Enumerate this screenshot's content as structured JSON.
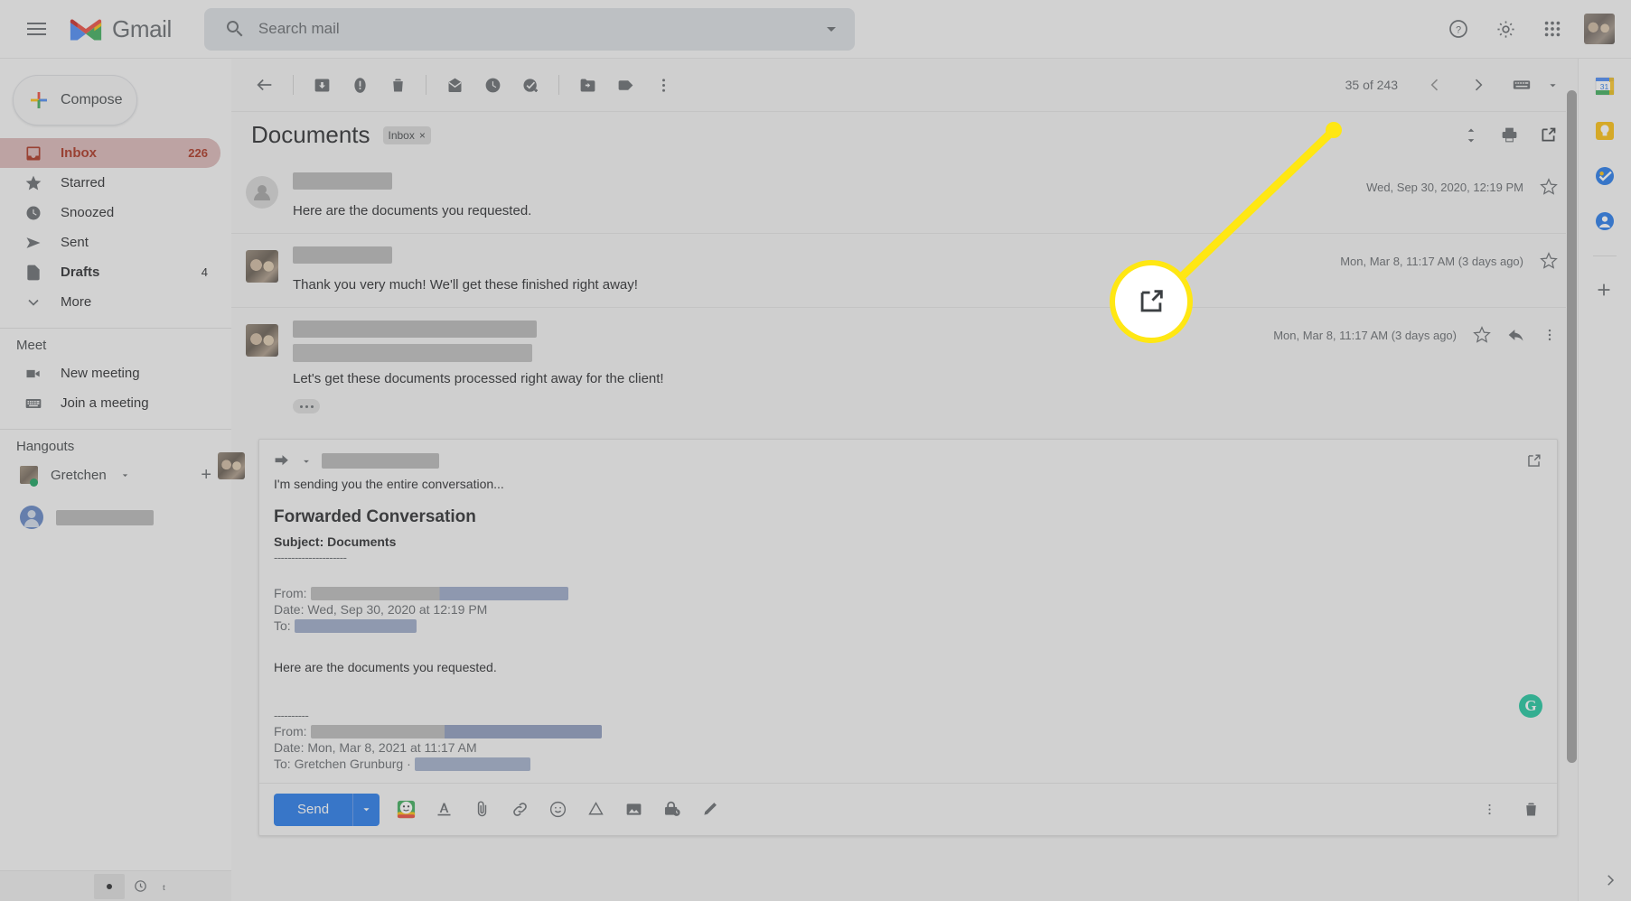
{
  "app": {
    "name": "Gmail"
  },
  "header": {
    "menu_icon": "hamburger-icon",
    "logo_icon": "gmail-logo-icon",
    "brand": "Gmail",
    "search": {
      "placeholder": "Search mail",
      "value": "",
      "icon": "search-icon",
      "options_icon": "chevron-down-icon"
    },
    "help_icon": "help-icon",
    "settings_icon": "gear-icon",
    "apps_icon": "apps-grid-icon",
    "avatar": "account-avatar"
  },
  "sidebar": {
    "compose": {
      "label": "Compose",
      "icon": "plus-icon"
    },
    "items": [
      {
        "label": "Inbox",
        "count": "226",
        "icon": "inbox-icon",
        "active": true
      },
      {
        "label": "Starred",
        "count": "",
        "icon": "star-icon",
        "active": false
      },
      {
        "label": "Snoozed",
        "count": "",
        "icon": "clock-icon",
        "active": false
      },
      {
        "label": "Sent",
        "count": "",
        "icon": "send-icon",
        "active": false
      },
      {
        "label": "Drafts",
        "count": "4",
        "icon": "draft-icon",
        "active": false
      },
      {
        "label": "More",
        "count": "",
        "icon": "chevron-down-icon",
        "active": false
      }
    ],
    "meet": {
      "title": "Meet",
      "items": [
        {
          "label": "New meeting",
          "icon": "video-camera-icon"
        },
        {
          "label": "Join a meeting",
          "icon": "keyboard-icon"
        }
      ]
    },
    "hangouts": {
      "title": "Hangouts",
      "user": "Gretchen",
      "status_icon": "online-dot-icon",
      "dropdown_icon": "caret-down-icon",
      "add_icon": "plus-icon",
      "contact_name_redacted": true
    }
  },
  "toolbar": {
    "back_icon": "back-arrow-icon",
    "archive_icon": "archive-icon",
    "spam_icon": "report-spam-icon",
    "delete_icon": "trash-icon",
    "unread_icon": "mark-unread-icon",
    "snooze_icon": "snooze-clock-icon",
    "tasks_icon": "add-to-tasks-icon",
    "moveto_icon": "move-to-folder-icon",
    "labels_icon": "label-tag-icon",
    "more_icon": "more-vertical-icon",
    "pagination": "35 of 243",
    "prev_icon": "chevron-left-icon",
    "next_icon": "chevron-right-icon",
    "input_tools_icon": "keyboard-icon",
    "input_tools_caret": "caret-down-icon"
  },
  "thread": {
    "subject": "Documents",
    "label_chip": "Inbox",
    "label_chip_remove": "×",
    "collapse_icon": "expand-collapse-icon",
    "print_icon": "print-icon",
    "popout_icon": "open-in-new-window-icon"
  },
  "messages": [
    {
      "sender_redacted": true,
      "snippet": "Here are the documents you requested.",
      "date": "Wed, Sep 30, 2020, 12:19 PM",
      "star_icon": "star-outline-icon",
      "avatar_type": "placeholder"
    },
    {
      "sender_redacted": true,
      "snippet": "Thank you very much! We'll get these finished right away!",
      "date": "Mon, Mar 8, 11:17 AM (3 days ago)",
      "star_icon": "star-outline-icon",
      "avatar_type": "photo"
    },
    {
      "sender_redacted": true,
      "snippet": "Let's get these documents processed right away for the client!",
      "date": "Mon, Mar 8, 11:17 AM (3 days ago)",
      "star_icon": "star-outline-icon",
      "reply_icon": "reply-arrow-icon",
      "more_icon": "more-vertical-icon",
      "avatar_type": "photo",
      "expander_icon": "show-trimmed-content-icon"
    }
  ],
  "compose": {
    "forward_icon": "forward-arrow-icon",
    "recipient_caret_icon": "caret-down-icon",
    "recipient_redacted": true,
    "popout_icon": "open-in-new-window-icon",
    "intro_line": "I'm sending you the entire conversation...",
    "forwarded_title": "Forwarded Conversation",
    "forwarded_subject": "Subject: Documents",
    "divider_long": "---------------------",
    "divider_short": "----------",
    "block1": {
      "from_label": "From:",
      "date_label": "Date: Wed, Sep 30, 2020 at 12:19 PM",
      "to_label": "To:"
    },
    "body_line": "Here are the documents you requested.",
    "block2": {
      "from_label": "From:",
      "date_label": "Date: Mon, Mar 8, 2021 at 11:17 AM",
      "to_label": "To: Gretchen Grunburg ·"
    },
    "send_label": "Send",
    "send_caret_icon": "caret-down-icon",
    "toolbar_icons": [
      "smart-compose-avatar-icon",
      "formatting-options-icon",
      "attach-file-icon",
      "insert-link-icon",
      "insert-emoji-icon",
      "insert-drive-file-icon",
      "insert-photo-icon",
      "confidential-mode-icon",
      "insert-signature-icon"
    ],
    "more_options_icon": "more-vertical-icon",
    "discard_icon": "trash-icon",
    "grammarly_badge": "G"
  },
  "right_rail": {
    "icons": [
      "google-calendar-icon",
      "google-keep-icon",
      "google-tasks-icon",
      "google-contacts-icon"
    ],
    "add_icon": "plus-icon",
    "expand_icon": "chevron-right-icon"
  },
  "status_bar": {
    "account_dot_icon": "active-account-dot-icon",
    "clock_icon": "clock-icon",
    "cursor_icon": "text-cursor-icon"
  },
  "highlight": {
    "target": "open-in-new-window-icon",
    "color": "#ffe713"
  }
}
